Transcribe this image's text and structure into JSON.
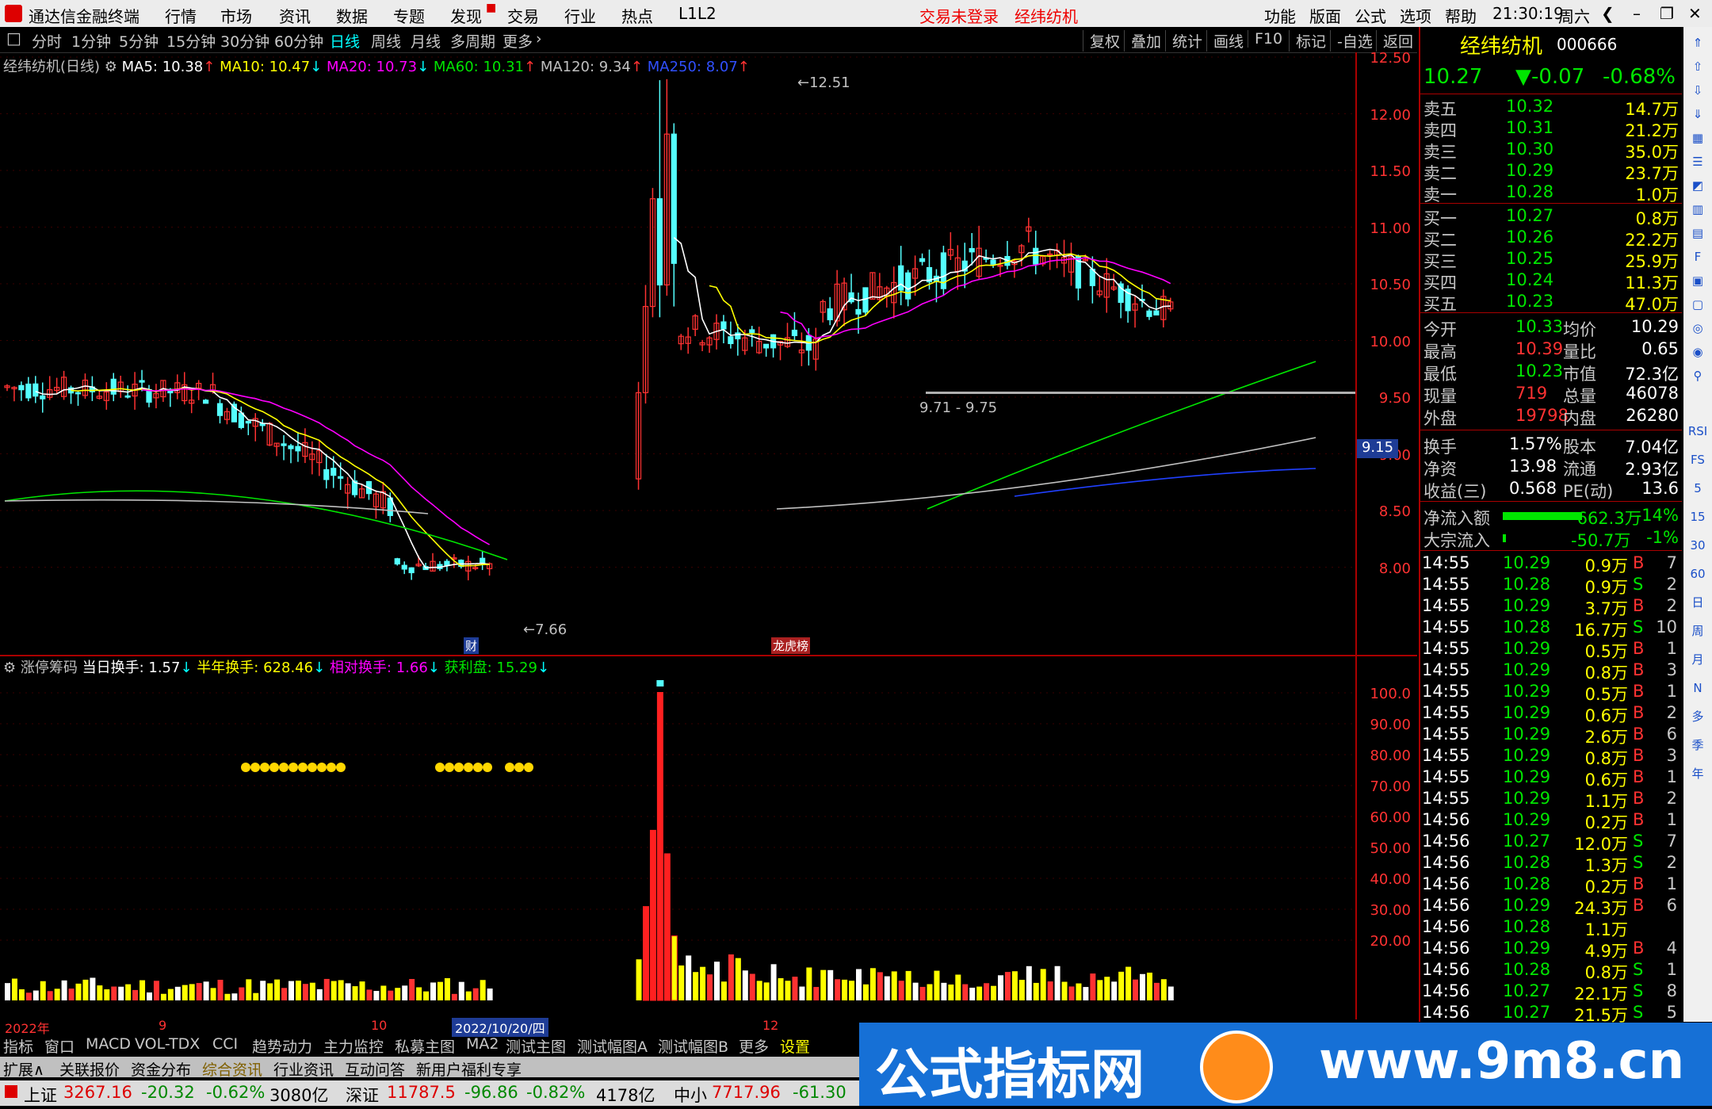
{
  "menu": {
    "app_title": "通达信金融终端",
    "items": [
      "行情",
      "市场",
      "资讯",
      "数据",
      "专题",
      "发现",
      "交易",
      "行业",
      "热点",
      "L1L2"
    ],
    "login_status": "交易未登录",
    "stock_name": "经纬纺机",
    "right_items": [
      "功能",
      "版面",
      "公式",
      "选项",
      "帮助"
    ],
    "time": "21:30:19",
    "weekday": "周六"
  },
  "periods": [
    "分时",
    "1分钟",
    "5分钟",
    "15分钟",
    "30分钟",
    "60分钟",
    "日线",
    "周线",
    "月线",
    "多周期",
    "更多"
  ],
  "selected_period": "日线",
  "tools": [
    "复权",
    "叠加",
    "统计",
    "画线",
    "F10",
    "标记",
    "-自选",
    "返回"
  ],
  "ma_legend": {
    "title": "经纬纺机(日线)",
    "ma5": "MA5: 10.38",
    "ma10": "MA10: 10.47",
    "ma20": "MA20: 10.73",
    "ma60": "MA60: 10.31",
    "ma120": "MA120: 9.34",
    "ma250": "MA250: 8.07"
  },
  "price_axis": [
    "12.50",
    "12.00",
    "11.50",
    "11.00",
    "10.50",
    "10.00",
    "9.50",
    "9.00",
    "8.50",
    "8.00"
  ],
  "price_marker": "9.15",
  "annotations": {
    "high": "12.51",
    "low": "7.66",
    "range": "9.71 - 9.75",
    "tag1": "财",
    "tag2": "龙虎榜"
  },
  "indicator_legend": {
    "name": "涨停筹码",
    "today": "当日换手: 1.57",
    "half_year": "半年换手: 628.46",
    "relative": "相对换手: 1.66",
    "profit": "获利盘: 15.29"
  },
  "indicator_axis": [
    "100.0",
    "90.00",
    "80.00",
    "70.00",
    "60.00",
    "50.00",
    "40.00",
    "30.00",
    "20.00"
  ],
  "date_axis": [
    "2022年",
    "9",
    "10",
    "2022/10/20/四",
    "12"
  ],
  "quote": {
    "name": "经纬纺机",
    "code": "000666",
    "price": "10.27",
    "change": "▼-0.07",
    "pct": "-0.68%",
    "asks": [
      {
        "label": "卖五",
        "price": "10.32",
        "vol": "14.7万"
      },
      {
        "label": "卖四",
        "price": "10.31",
        "vol": "21.2万"
      },
      {
        "label": "卖三",
        "price": "10.30",
        "vol": "35.0万"
      },
      {
        "label": "卖二",
        "price": "10.29",
        "vol": "23.7万"
      },
      {
        "label": "卖一",
        "price": "10.28",
        "vol": "1.0万"
      }
    ],
    "bids": [
      {
        "label": "买一",
        "price": "10.27",
        "vol": "0.8万"
      },
      {
        "label": "买二",
        "price": "10.26",
        "vol": "22.2万"
      },
      {
        "label": "买三",
        "price": "10.25",
        "vol": "25.9万"
      },
      {
        "label": "买四",
        "price": "10.24",
        "vol": "11.3万"
      },
      {
        "label": "买五",
        "price": "10.23",
        "vol": "47.0万"
      }
    ],
    "stats": [
      {
        "l1": "今开",
        "v1": "10.33",
        "l2": "均价",
        "v2": "10.29"
      },
      {
        "l1": "最高",
        "v1": "10.39",
        "l2": "量比",
        "v2": "0.65"
      },
      {
        "l1": "最低",
        "v1": "10.23",
        "l2": "市值",
        "v2": "72.3亿"
      },
      {
        "l1": "现量",
        "v1": "719",
        "l2": "总量",
        "v2": "46078"
      },
      {
        "l1": "外盘",
        "v1": "19798",
        "l2": "内盘",
        "v2": "26280"
      }
    ],
    "stats2": [
      {
        "l1": "换手",
        "v1": "1.57%",
        "l2": "股本",
        "v2": "7.04亿"
      },
      {
        "l1": "净资",
        "v1": "13.98",
        "l2": "流通",
        "v2": "2.93亿"
      },
      {
        "l1": "收益(三)",
        "v1": "0.568",
        "l2": "PE(动)",
        "v2": "13.6"
      }
    ],
    "flows": [
      {
        "label": "净流入额",
        "value": "-662.3万",
        "pct": "-14%"
      },
      {
        "label": "大宗流入",
        "value": "-50.7万",
        "pct": "-1%"
      }
    ],
    "ticks": [
      [
        "14:55",
        "10.29",
        "0.9万",
        "B",
        "7"
      ],
      [
        "14:55",
        "10.28",
        "0.9万",
        "S",
        "2"
      ],
      [
        "14:55",
        "10.29",
        "3.7万",
        "B",
        "2"
      ],
      [
        "14:55",
        "10.28",
        "16.7万",
        "S",
        "10"
      ],
      [
        "14:55",
        "10.29",
        "0.5万",
        "B",
        "1"
      ],
      [
        "14:55",
        "10.29",
        "0.8万",
        "B",
        "3"
      ],
      [
        "14:55",
        "10.29",
        "0.5万",
        "B",
        "1"
      ],
      [
        "14:55",
        "10.29",
        "0.6万",
        "B",
        "2"
      ],
      [
        "14:55",
        "10.29",
        "2.6万",
        "B",
        "6"
      ],
      [
        "14:55",
        "10.29",
        "0.8万",
        "B",
        "3"
      ],
      [
        "14:55",
        "10.29",
        "0.6万",
        "B",
        "1"
      ],
      [
        "14:55",
        "10.29",
        "1.1万",
        "B",
        "2"
      ],
      [
        "14:56",
        "10.29",
        "0.2万",
        "B",
        "1"
      ],
      [
        "14:56",
        "10.27",
        "12.0万",
        "S",
        "7"
      ],
      [
        "14:56",
        "10.28",
        "1.3万",
        "S",
        "2"
      ],
      [
        "14:56",
        "10.28",
        "0.2万",
        "B",
        "1"
      ],
      [
        "14:56",
        "10.29",
        "24.3万",
        "B",
        "6"
      ],
      [
        "14:56",
        "10.28",
        "1.1万",
        "",
        ""
      ],
      [
        "14:56",
        "10.29",
        "4.9万",
        "B",
        "4"
      ],
      [
        "14:56",
        "10.28",
        "0.8万",
        "S",
        "1"
      ],
      [
        "14:56",
        "10.27",
        "22.1万",
        "S",
        "8"
      ],
      [
        "14:56",
        "10.27",
        "21.5万",
        "S",
        "5"
      ]
    ]
  },
  "sidebar_labels": [
    "RSI",
    "FS",
    "5",
    "15",
    "30",
    "60",
    "日",
    "周",
    "月",
    "N",
    "多",
    "季",
    "年"
  ],
  "bottom_tabs": [
    "指标",
    "窗口",
    "MACD",
    "VOL-TDX",
    "CCI",
    "趋势动力",
    "主力监控",
    "私募主图",
    "MA2",
    "测试主图",
    "测试幅图A",
    "测试幅图B",
    "更多",
    "设置"
  ],
  "bottom_tabs2": [
    "扩展∧",
    "关联报价",
    "资金分布",
    "综合资讯",
    "行业资讯",
    "互动问答",
    "新用户福利专享"
  ],
  "status_bar": {
    "sh_label": "上证",
    "sh_val": "3267.16",
    "sh_chg": "-20.32",
    "sh_pct": "-0.62%",
    "sh_amt": "3080亿",
    "sz_label": "深证",
    "sz_val": "11787.5",
    "sz_chg": "-96.86",
    "sz_pct": "-0.82%",
    "sz_amt": "4178亿",
    "zx_label": "中小",
    "zx_val": "7717.96",
    "zx_chg": "-61.30"
  },
  "banner": {
    "title": "公式指标网",
    "url": "www.9m8.cn"
  },
  "chart_data": {
    "type": "candlestick",
    "price_range": [
      7.5,
      12.7
    ],
    "ma_series": [
      "MA5",
      "MA10",
      "MA20",
      "MA60",
      "MA120",
      "MA250"
    ],
    "colors": {
      "up": "#ff3232",
      "down": "#54ffff",
      "ma5": "#ffffff",
      "ma10": "#ffff00",
      "ma20": "#ff00ff",
      "ma60": "#00e600",
      "ma120": "#c0c0c0",
      "ma250": "#2040ff"
    }
  }
}
